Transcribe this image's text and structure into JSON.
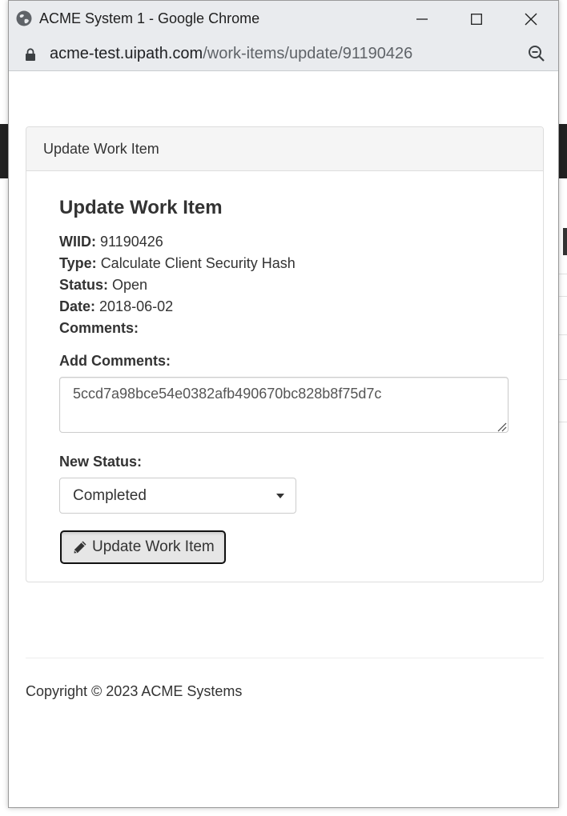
{
  "window": {
    "title": "ACME System 1 - Google Chrome",
    "url_host": "acme-test.uipath.com",
    "url_path": "/work-items/update/91190426"
  },
  "panel": {
    "heading": "Update Work Item",
    "title": "Update Work Item",
    "fields": {
      "wiid_label": "WIID:",
      "wiid_value": "91190426",
      "type_label": "Type:",
      "type_value": "Calculate Client Security Hash",
      "status_label": "Status:",
      "status_value": "Open",
      "date_label": "Date:",
      "date_value": "2018-06-02",
      "comments_label": "Comments:"
    },
    "add_comments_label": "Add Comments:",
    "add_comments_value": "5ccd7a98bce54e0382afb490670bc828b8f75d7c",
    "new_status_label": "New Status:",
    "new_status_value": "Completed",
    "update_button_label": "Update Work Item"
  },
  "footer": {
    "copyright": "Copyright © 2023 ACME Systems"
  },
  "icons": {
    "globe": "globe-icon",
    "lock": "lock-icon",
    "zoom": "zoom-icon",
    "pencil": "pencil-icon",
    "caret": "caret-down-icon"
  }
}
